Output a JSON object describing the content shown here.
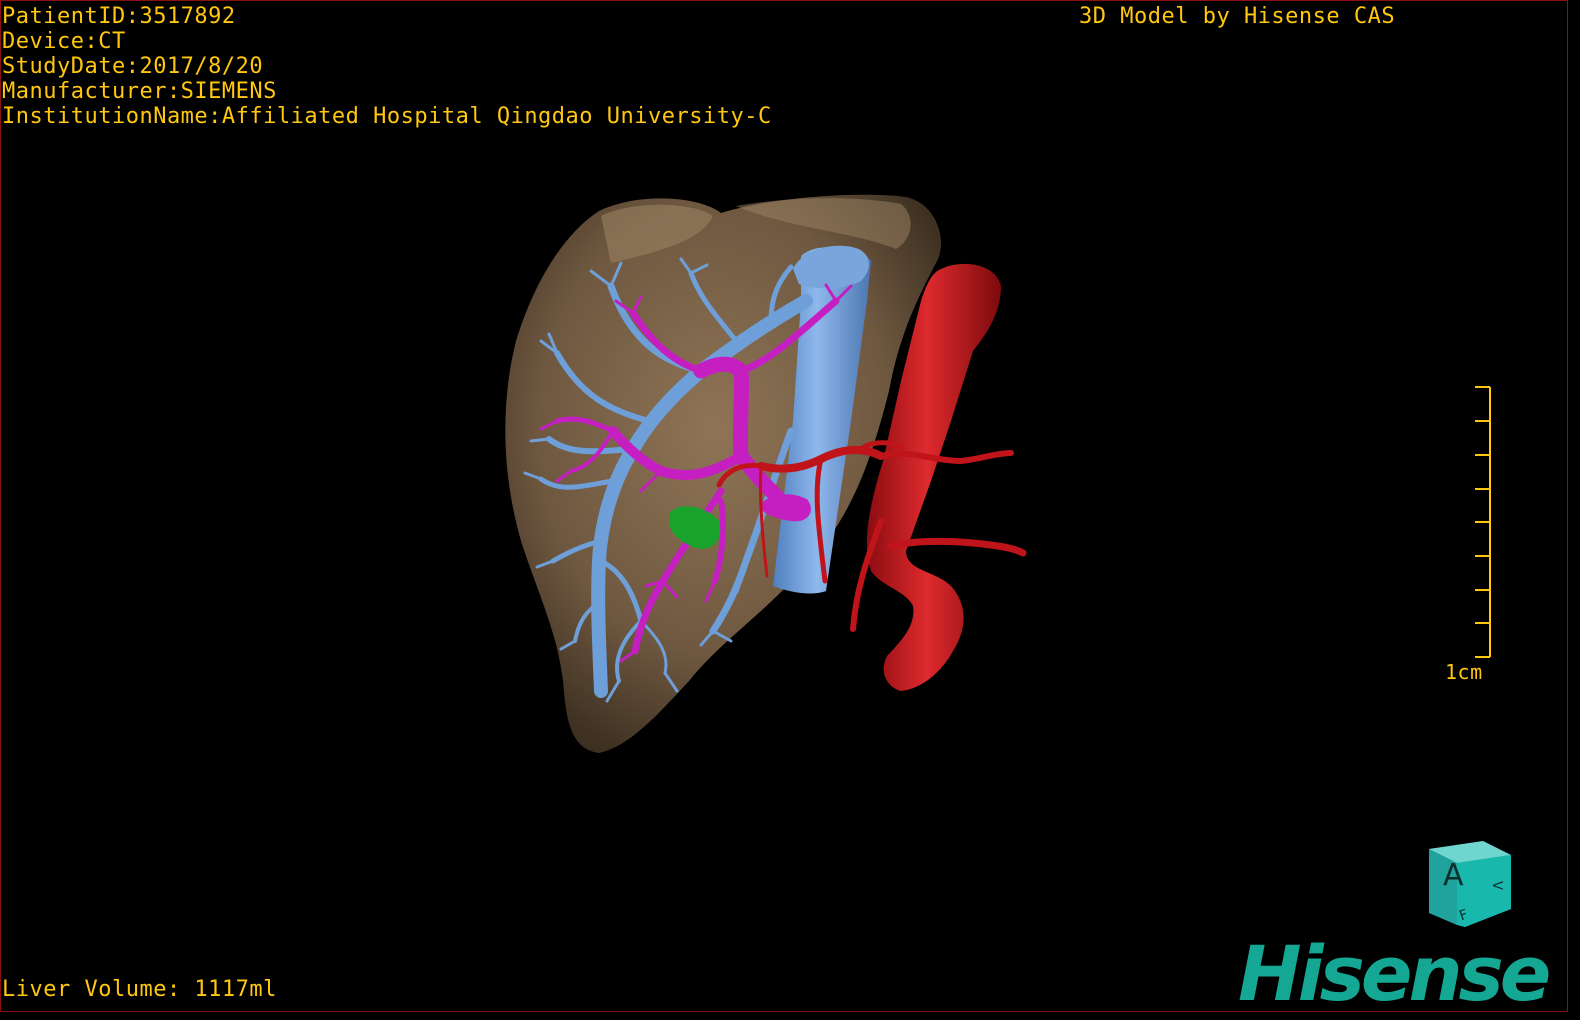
{
  "info": {
    "patient_id": "PatientID:3517892",
    "device": "Device:CT",
    "study_date": "StudyDate:2017/8/20",
    "manufacturer": "Manufacturer:SIEMENS",
    "institution": "InstitutionName:Affiliated Hospital Qingdao University-C"
  },
  "credit": "3D Model by Hisense CAS",
  "scale_bar": {
    "label": "1cm"
  },
  "liver_volume": "Liver Volume: 1117ml",
  "orientation_cube": {
    "front_letter": "A",
    "side_letter": "V",
    "bottom_letter": "F"
  },
  "brand_logo": "Hisense",
  "colors": {
    "overlay_text": "#ffc70f",
    "liver": "#7a6245",
    "hepatic_vein": "#6e9fd8",
    "portal_vein": "#c51fc2",
    "artery_aorta": "#c0141a",
    "gallbladder_mass": "#1aa32c",
    "brand": "#14a894"
  }
}
